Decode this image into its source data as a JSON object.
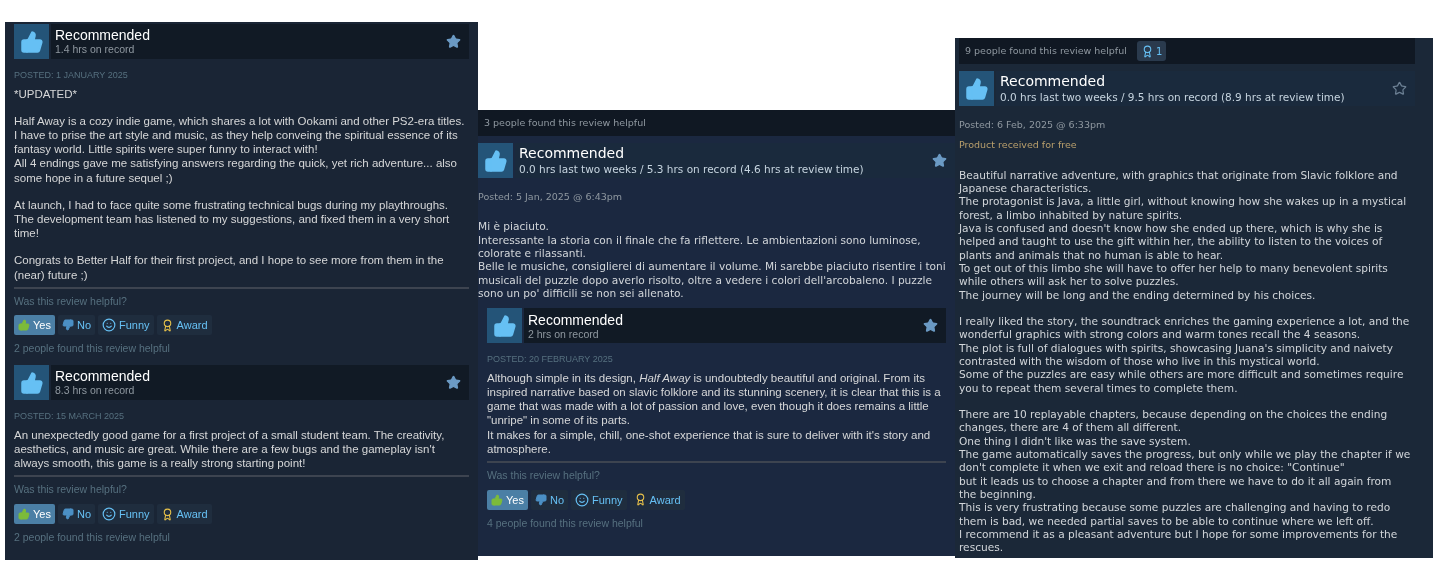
{
  "columns": [
    {
      "reviews": [
        {
          "kind": "classic",
          "verdict": "Recommended",
          "hours": "1.4 hrs on record",
          "starred": true,
          "posted": "POSTED: 1 JANUARY 2025",
          "body": [
            "*UPDATED*",
            "Half Away is a cozy indie game, which shares a lot with Ookami and other PS2-era titles.\nI have to prise the art style and music, as they help conveing the spiritual essence of its fantasy world. Little spirits were super funny to interact with!\nAll 4 endings gave me satisfying answers regarding the quick, yet rich adventure... also some hope in a future sequel ;)",
            "At launch, I had to face quite some frustrating technical bugs during my playthroughs. The development team has listened to my suggestions, and fixed them in a very short time!",
            "Congrats to Better Half for their first project, and I hope to see more from them in the (near) future ;)"
          ],
          "question": "Was this review helpful?",
          "buttons": [
            {
              "kind": "yes",
              "label": "Yes",
              "selected": true
            },
            {
              "kind": "no",
              "label": "No",
              "selected": false
            },
            {
              "kind": "funny",
              "label": "Funny",
              "selected": false
            },
            {
              "kind": "award",
              "label": "Award",
              "selected": false
            }
          ],
          "helpful": "2 people found this review helpful"
        },
        {
          "kind": "classic",
          "verdict": "Recommended",
          "hours": "8.3 hrs on record",
          "starred": true,
          "posted": "POSTED: 15 MARCH 2025",
          "body": [
            "An unexpectedly good game for a first project of a small student team. The creativity, aesthetics, and music are great. While there are a few bugs and the gameplay isn't always smooth, this game is a really strong starting point!"
          ],
          "question": "Was this review helpful?",
          "buttons": [
            {
              "kind": "yes",
              "label": "Yes",
              "selected": true
            },
            {
              "kind": "no",
              "label": "No",
              "selected": false
            },
            {
              "kind": "funny",
              "label": "Funny",
              "selected": false
            },
            {
              "kind": "award",
              "label": "Award",
              "selected": false
            }
          ],
          "helpful": "2 people found this review helpful"
        }
      ]
    },
    {
      "reviews": [
        {
          "kind": "modern",
          "banner": "3 people found this review helpful",
          "verdict": "Recommended",
          "hours": "0.0 hrs last two weeks / 5.3 hrs on record (4.6 hrs at review time)",
          "starred": true,
          "posted": "Posted: 5 Jan, 2025 @ 6:43pm",
          "body": [
            "Mi è piaciuto.\nInteressante la storia con il finale che fa riflettere. Le ambientazioni sono luminose, colorate e rilassanti.\nBelle le musiche, consiglierei di aumentare il volume. Mi sarebbe piaciuto risentire i toni musicali del puzzle dopo averlo risolto, oltre a vedere i colori dell'arcobaleno. I puzzle sono un po' difficili se non sei allenato."
          ]
        },
        {
          "kind": "classic",
          "formatted": true,
          "verdict": "Recommended",
          "hours": "2 hrs on record",
          "starred": true,
          "posted": "POSTED: 20 FEBRUARY 2025",
          "body": [
            "Although simple in its design, *Half Away* is undoubtedly beautiful and original. From its inspired narrative based on slavic folklore and its stunning scenery, it is clear that this is a game that was made with a lot of passion and love, even though it does remains a little \"unripe\" in some of its parts.\nIt makes for a simple, chill, one-shot experience that is sure to deliver with it's story and atmosphere."
          ],
          "question": "Was this review helpful?",
          "buttons": [
            {
              "kind": "yes",
              "label": "Yes",
              "selected": true
            },
            {
              "kind": "no",
              "label": "No",
              "selected": false
            },
            {
              "kind": "funny",
              "label": "Funny",
              "selected": false
            },
            {
              "kind": "award",
              "label": "Award",
              "selected": false
            }
          ],
          "helpful": "4 people found this review helpful"
        }
      ]
    },
    {
      "reviews": [
        {
          "kind": "modern",
          "banner": "9 people found this review helpful",
          "awards": "1",
          "verdict": "Recommended",
          "hours": "0.0 hrs last two weeks / 9.5 hrs on record (8.9 hrs at review time)",
          "starred": false,
          "posted": "Posted: 6 Feb, 2025 @ 6:33pm",
          "free_note": "Product received for free",
          "body": [
            "Beautiful narrative adventure, with graphics that originate from Slavic folklore and Japanese characteristics.\nThe protagonist is Java, a little girl, without knowing how she wakes up in a mystical forest, a limbo inhabited by nature spirits.\nJava is confused and doesn't know how she ended up there, which is why she is helped and taught to use the gift within her, the ability to listen to the voices of plants and animals that no human is able to hear.\nTo get out of this limbo she will have to offer her help to many benevolent spirits while others will ask her to solve puzzles.\nThe journey will be long and the ending determined by his choices.",
            "I really liked the story, the soundtrack enriches the gaming experience a lot, and the wonderful graphics with strong colors and warm tones recall the 4 seasons.\nThe plot is full of dialogues with spirits, showcasing Juana's simplicity and naivety contrasted with the wisdom of those who live in this mystical world.\nSome of the puzzles are easy while others are more difficult and sometimes require you to repeat them several times to complete them.",
            "There are 10 replayable chapters, because depending on the choices the ending changes, there are 4 of them all different.\nOne thing I didn't like was the save system.\nThe game automatically saves the progress, but only while we play the chapter if we don't complete it when we exit and reload there is no choice: \"Continue\"\nbut it leads us to choose a chapter and from there we have to do it all again from the beginning.\nThis is very frustrating because some puzzles are challenging and having to redo them is bad, we needed partial saves to be able to continue where we left off.\nI recommend it as a pleasant adventure but I hope for some improvements for the rescues."
          ]
        }
      ]
    }
  ]
}
